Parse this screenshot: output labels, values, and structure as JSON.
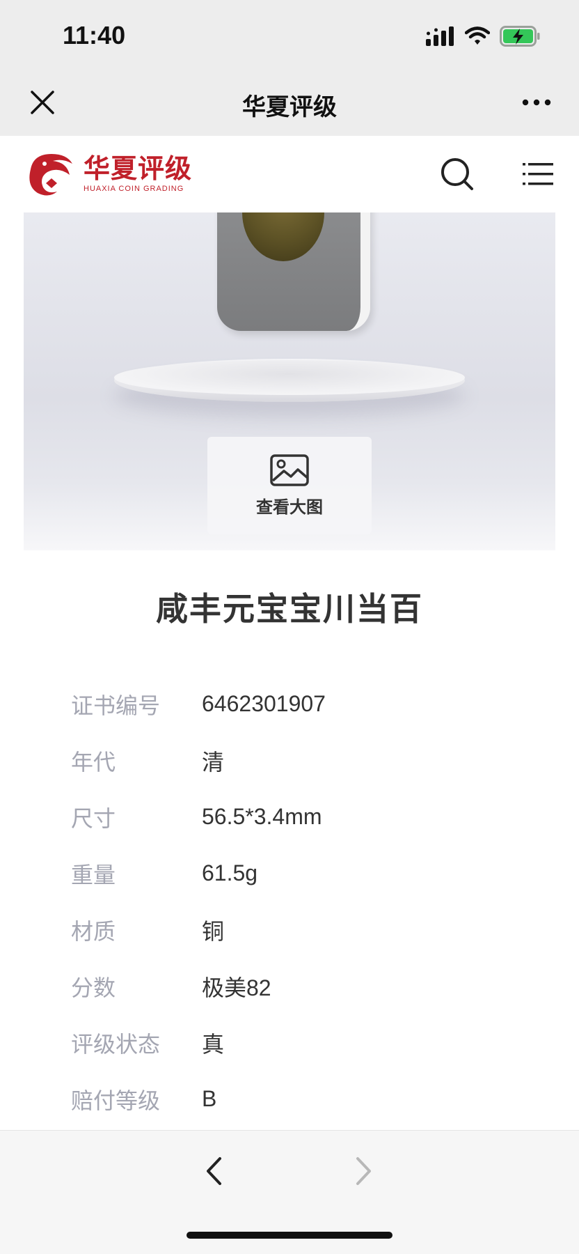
{
  "status_bar": {
    "time": "11:40",
    "icons": [
      "signal-icon",
      "wifi-icon",
      "battery-charging-icon"
    ],
    "battery_color": "#34c759"
  },
  "title_bar": {
    "title": "华夏评级",
    "close_icon": "close-icon",
    "more_icon": "more-icon"
  },
  "site_header": {
    "logo_cn": "华夏评级",
    "logo_en": "HUAXIA COIN GRADING",
    "brand_color": "#c0202a",
    "search_icon": "search-icon",
    "menu_icon": "menu-icon"
  },
  "product": {
    "view_big_label": "查看大图",
    "view_icon": "image-icon"
  },
  "coin": {
    "title": "咸丰元宝宝川当百"
  },
  "info": [
    {
      "label": "证书编号",
      "value": "6462301907"
    },
    {
      "label": "年代",
      "value": "清"
    },
    {
      "label": "尺寸",
      "value": "56.5*3.4mm"
    },
    {
      "label": "重量",
      "value": "61.5g"
    },
    {
      "label": "材质",
      "value": "铜"
    },
    {
      "label": "分数",
      "value": "极美82"
    },
    {
      "label": "评级状态",
      "value": "真"
    },
    {
      "label": "赔付等级",
      "value": "B"
    }
  ],
  "bottom_nav": {
    "back_icon": "chevron-left-icon",
    "forward_icon": "chevron-right-icon"
  }
}
